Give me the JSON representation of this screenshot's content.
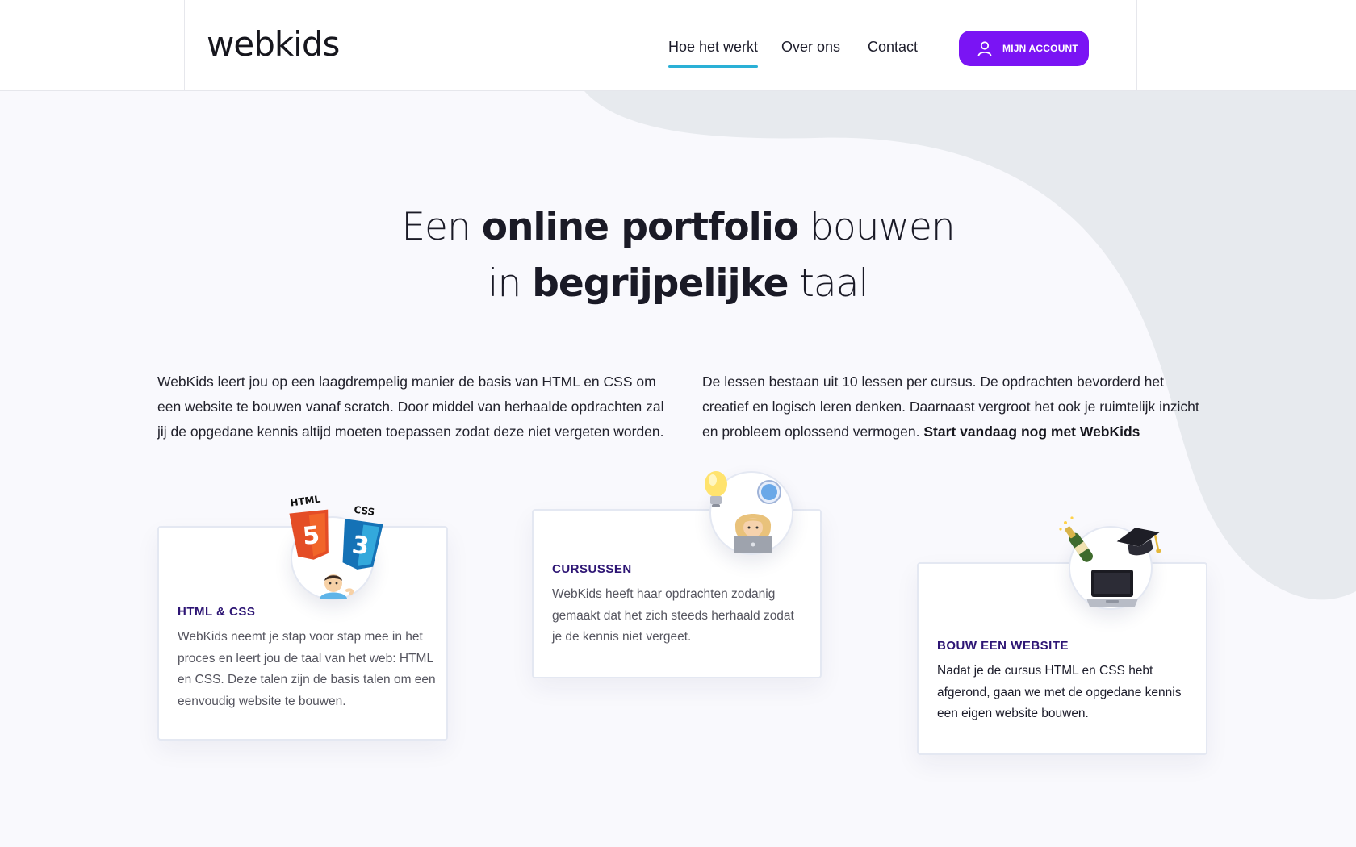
{
  "brand": {
    "logo": "webkids"
  },
  "nav": {
    "items": [
      {
        "label": "Hoe het werkt",
        "active": true
      },
      {
        "label": "Over ons",
        "active": false
      },
      {
        "label": "Contact",
        "active": false
      }
    ],
    "account_button": "MIJN ACCOUNT",
    "account_icon": "user-icon"
  },
  "hero": {
    "line1_a": "Een",
    "line1_b": "online portfolio",
    "line1_c": "bouwen",
    "line2_a": "in",
    "line2_b": "begrijpelijke",
    "line2_c": "taal"
  },
  "intro": {
    "left": "WebKids leert jou op een laagdrempelig manier de basis van HTML en CSS om een website te bouwen vanaf scratch. Door middel van herhaalde opdrachten zal jij de opgedane kennis altijd moeten toepassen zodat deze niet vergeten worden.",
    "right": "De lessen bestaan uit 10 lessen per cursus. De opdrachten bevorderd het creatief en logisch leren denken. Daarnaast vergroot het ook je ruimtelijk inzicht en probleem oplossend vermogen.",
    "right_cta": "Start vandaag nog met WebKids"
  },
  "cards": [
    {
      "title": "HTML & CSS",
      "text": "WebKids neemt je stap voor stap mee in het proces en leert jou de taal van het web: HTML en CSS. Deze talen zijn de basis talen om een eenvoudig website te bouwen.",
      "badge_labels": [
        "HTML",
        "CSS"
      ],
      "icon": "html-css-developer-icon"
    },
    {
      "title": "CURSUSSEN",
      "text": "WebKids heeft haar opdrachten zodanig gemaakt dat het zich steeds herhaald zodat je de kennis niet vergeet.",
      "icon": "student-laptop-lightbulb-icon"
    },
    {
      "title": "BOUW EEN WEBSITE",
      "text": "Nadat je de cursus HTML en CSS hebt afgerond, gaan we met de opgedane kennis een eigen website bouwen.",
      "icon": "graduation-laptop-champagne-icon"
    }
  ],
  "colors": {
    "accent": "#7a14f4",
    "nav_underline": "#2ab0d6",
    "card_title": "#2d1574",
    "blob": "#e7eaee",
    "page_bg": "#f9f9fd"
  }
}
